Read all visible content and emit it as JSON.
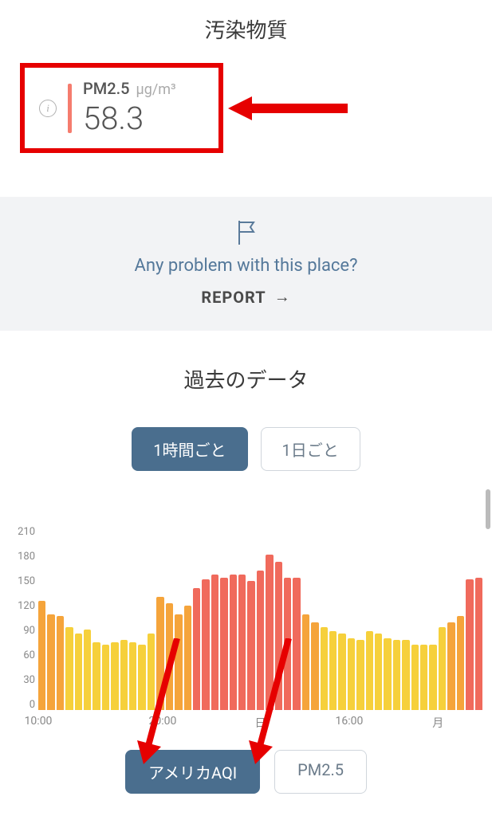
{
  "pollutant_section_title": "汚染物質",
  "pollutant": {
    "name": "PM2.5",
    "unit": "µg/m³",
    "value": "58.3"
  },
  "report": {
    "question": "Any problem with this place?",
    "button": "REPORT",
    "arrow": "→"
  },
  "history_title": "過去のデータ",
  "interval_tabs": {
    "hourly": "1時間ごと",
    "daily": "1日ごと"
  },
  "metric_tabs": {
    "aqi": "アメリカAQI",
    "pm25": "PM2.5"
  },
  "chart_data": {
    "type": "bar",
    "title": "",
    "xlabel": "",
    "ylabel": "",
    "ylim": [
      0,
      210
    ],
    "yticks": [
      0,
      30,
      60,
      90,
      120,
      150,
      180,
      210
    ],
    "x_tick_labels": [
      {
        "pos": 0.0,
        "label": "10:00"
      },
      {
        "pos": 0.28,
        "label": "20:00"
      },
      {
        "pos": 0.5,
        "label": "日"
      },
      {
        "pos": 0.7,
        "label": "16:00"
      },
      {
        "pos": 0.9,
        "label": "月"
      }
    ],
    "values": [
      125,
      110,
      108,
      95,
      88,
      92,
      78,
      75,
      78,
      80,
      78,
      75,
      88,
      130,
      122,
      110,
      120,
      140,
      150,
      155,
      152,
      155,
      155,
      148,
      160,
      178,
      170,
      152,
      152,
      110,
      100,
      95,
      90,
      88,
      82,
      80,
      90,
      88,
      82,
      80,
      80,
      75,
      75,
      75,
      95,
      100,
      108,
      150,
      152
    ]
  },
  "colors": {
    "low": "#f6d03b",
    "mid": "#f5a43b",
    "high": "#f06a5c"
  }
}
